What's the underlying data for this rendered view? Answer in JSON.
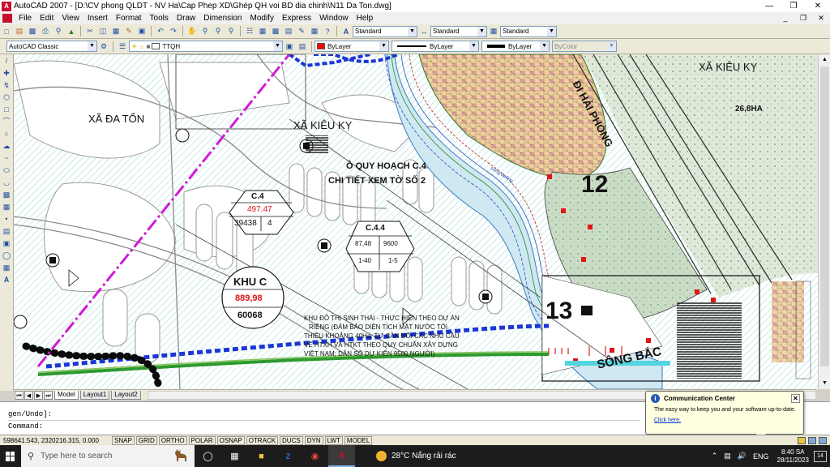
{
  "window": {
    "title": "AutoCAD 2007 - [D:\\CV phong QLDT - NV Ha\\Cap Phep XD\\Ghép QH voi BD dia chinh\\N11 Da Ton.dwg]",
    "app_icon_letter": "A"
  },
  "menu": {
    "items": [
      "File",
      "Edit",
      "View",
      "Insert",
      "Format",
      "Tools",
      "Draw",
      "Dimension",
      "Modify",
      "Express",
      "Window",
      "Help"
    ]
  },
  "toolbar": {
    "text_style": "Standard",
    "dim_style": "Standard",
    "table_style": "Standard",
    "workspace": "AutoCAD Classic",
    "layer": "TTQH",
    "color": "ByLayer",
    "linetype": "ByLayer",
    "lineweight": "ByLayer",
    "plotstyle": "ByColor",
    "color_swatch": "#ff0000"
  },
  "drawing": {
    "labels": {
      "xa_da_ton": "XÃ ĐA TỐN",
      "xa_kieu_ky_mid": "XÃ KIÊU KỴ",
      "xa_kieu_ky_right": "XÃ KIÊU KỴ",
      "area": "26,8HA",
      "hai_phong": "ĐI HẢI PHÒNG",
      "quy_hoach_1": "Ô QUY HOẠCH C.4",
      "quy_hoach_2": "CHI TIẾT XEM TỜ SỐ 2",
      "zone_12": "12",
      "zone_13": "13",
      "song_bac": "SÔNG BẮC",
      "song_label": "sông đuống"
    },
    "tag_c4": {
      "name": "C.4",
      "value": "497.47",
      "left": "39438",
      "right": "4"
    },
    "tag_c44": {
      "name": "C.4.4",
      "tl": "87,48",
      "tr": "9600",
      "bl": "1-40",
      "br": "1-5"
    },
    "khu_c": {
      "name": "KHU C",
      "value": "889,98",
      "count": "60068"
    },
    "note": [
      "KHU ĐÔ THỊ SINH THÁI - THỰC HIỆN THEO DỰ ÁN",
      "RIÊNG (ĐẢM BẢO DIỆN TÍCH MẶT NƯỚC TỐI",
      "THIỂU KHOẢNG 40Ha; TỰ CÂN ĐỐI CÁC NHU CẦU",
      "VỀ HTXH VÀ HTKT THEO QUY CHUẨN XÂY DỰNG",
      "VIỆT NAM; DÂN SỐ DỰ KIẾN 9500 NGƯỜI)"
    ]
  },
  "layout_tabs": [
    "Model",
    "Layout1",
    "Layout2"
  ],
  "command": {
    "history": "gen/Undo]:",
    "prompt": "Command:"
  },
  "status": {
    "coords": "598641.543, 2320216.315, 0.000",
    "buttons": [
      "SNAP",
      "GRID",
      "ORTHO",
      "POLAR",
      "OSNAP",
      "OTRACK",
      "DUCS",
      "DYN",
      "LWT",
      "MODEL"
    ]
  },
  "comm_center": {
    "title": "Communication Center",
    "body": "The easy way to keep you and your software up-to-date.",
    "link": "Click here."
  },
  "taskbar": {
    "search_placeholder": "Type here to search",
    "weather": "28°C  Nắng rải rác",
    "lang": "ENG",
    "time": "8:40 SA",
    "date": "28/11/2023",
    "notif_count": "14"
  }
}
